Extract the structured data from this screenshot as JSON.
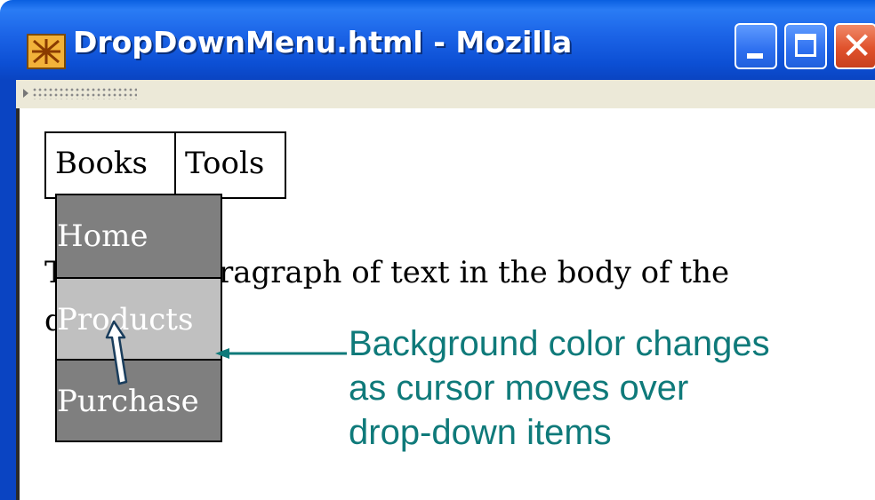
{
  "window": {
    "title": "DropDownMenu.html - Mozilla",
    "controls": {
      "minimize": "minimize",
      "maximize": "maximize",
      "close": "close"
    }
  },
  "menu": {
    "top_items": [
      "Books",
      "Tools"
    ],
    "dropdown_items": [
      "Home",
      "Products",
      "Purchase"
    ],
    "hovered_item": "Products"
  },
  "page": {
    "paragraph": "This is a paragraph of text in the body of the document."
  },
  "annotation": {
    "lines": [
      "Background color changes",
      "as cursor moves over",
      "drop-down items"
    ],
    "color": "#0f7a7a"
  },
  "colors": {
    "titlebar": "#1b63e6",
    "dropdown_bg": "#7f7f7f",
    "dropdown_hover_bg": "#c0c0c0",
    "close_button": "#e0522c"
  },
  "icons": {
    "app": "mozilla-icon",
    "cursor": "arrow-cursor-icon"
  }
}
